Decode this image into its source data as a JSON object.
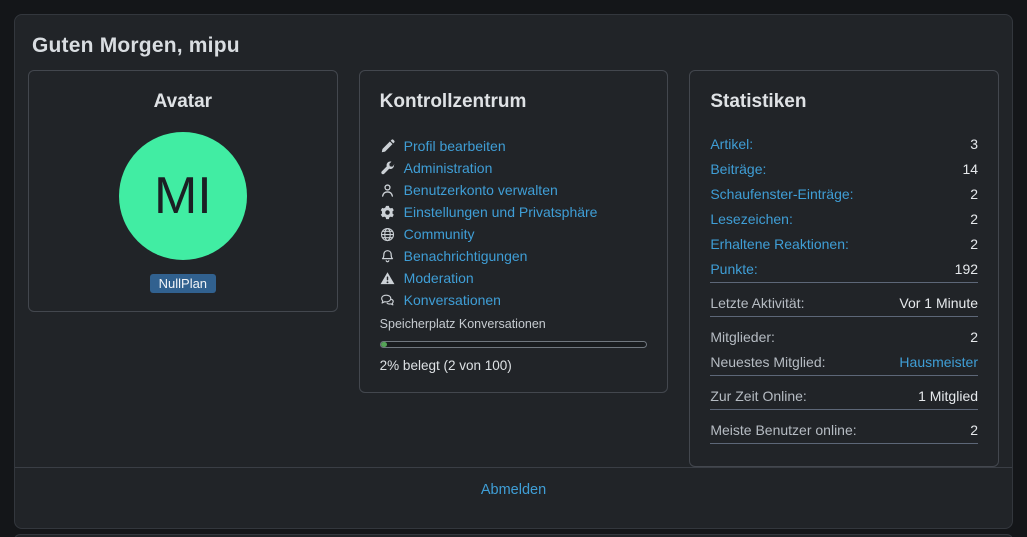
{
  "page": {
    "greeting": "Guten Morgen, mipu",
    "logout_label": "Abmelden"
  },
  "avatar_card": {
    "title": "Avatar",
    "initials": "MI",
    "badge": "NullPlan"
  },
  "control_card": {
    "title": "Kontrollzentrum",
    "links": [
      {
        "icon": "pencil-icon",
        "label": "Profil bearbeiten"
      },
      {
        "icon": "wrench-icon",
        "label": "Administration"
      },
      {
        "icon": "user-icon",
        "label": "Benutzerkonto verwalten"
      },
      {
        "icon": "gear-icon",
        "label": "Einstellungen und Privatsphäre"
      },
      {
        "icon": "globe-icon",
        "label": "Community"
      },
      {
        "icon": "bell-icon",
        "label": "Benachrichtigungen"
      },
      {
        "icon": "warning-icon",
        "label": "Moderation"
      },
      {
        "icon": "conversations-icon",
        "label": "Konversationen"
      }
    ],
    "storage_label": "Speicherplatz Konversationen",
    "storage_percent": 2,
    "storage_text": "2% belegt (2 von 100)"
  },
  "stats_card": {
    "title": "Statistiken",
    "groups": [
      {
        "rows": [
          {
            "label": "Artikel:",
            "value": "3",
            "label_link": true
          },
          {
            "label": "Beiträge:",
            "value": "14",
            "label_link": true
          },
          {
            "label": "Schaufenster-Einträge:",
            "value": "2",
            "label_link": true
          },
          {
            "label": "Lesezeichen:",
            "value": "2",
            "label_link": true
          },
          {
            "label": "Erhaltene Reaktionen:",
            "value": "2",
            "label_link": true
          },
          {
            "label": "Punkte:",
            "value": "192",
            "label_link": true
          }
        ]
      },
      {
        "rows": [
          {
            "label": "Letzte Aktivität:",
            "value": "Vor 1 Minute"
          }
        ]
      },
      {
        "rows": [
          {
            "label": "Mitglieder:",
            "value": "2"
          },
          {
            "label": "Neuestes Mitglied:",
            "value": "Hausmeister",
            "value_link": true
          }
        ]
      },
      {
        "rows": [
          {
            "label": "Zur Zeit Online:",
            "value": "1 Mitglied"
          }
        ]
      },
      {
        "rows": [
          {
            "label": "Meiste Benutzer online:",
            "value": "2"
          }
        ]
      }
    ]
  },
  "colors": {
    "accent_link": "#3f9ed6",
    "avatar_green": "#41eda3",
    "badge_blue": "#31618f",
    "progress_green": "#55a457",
    "panel_bg": "#212428",
    "page_bg": "#141619"
  }
}
